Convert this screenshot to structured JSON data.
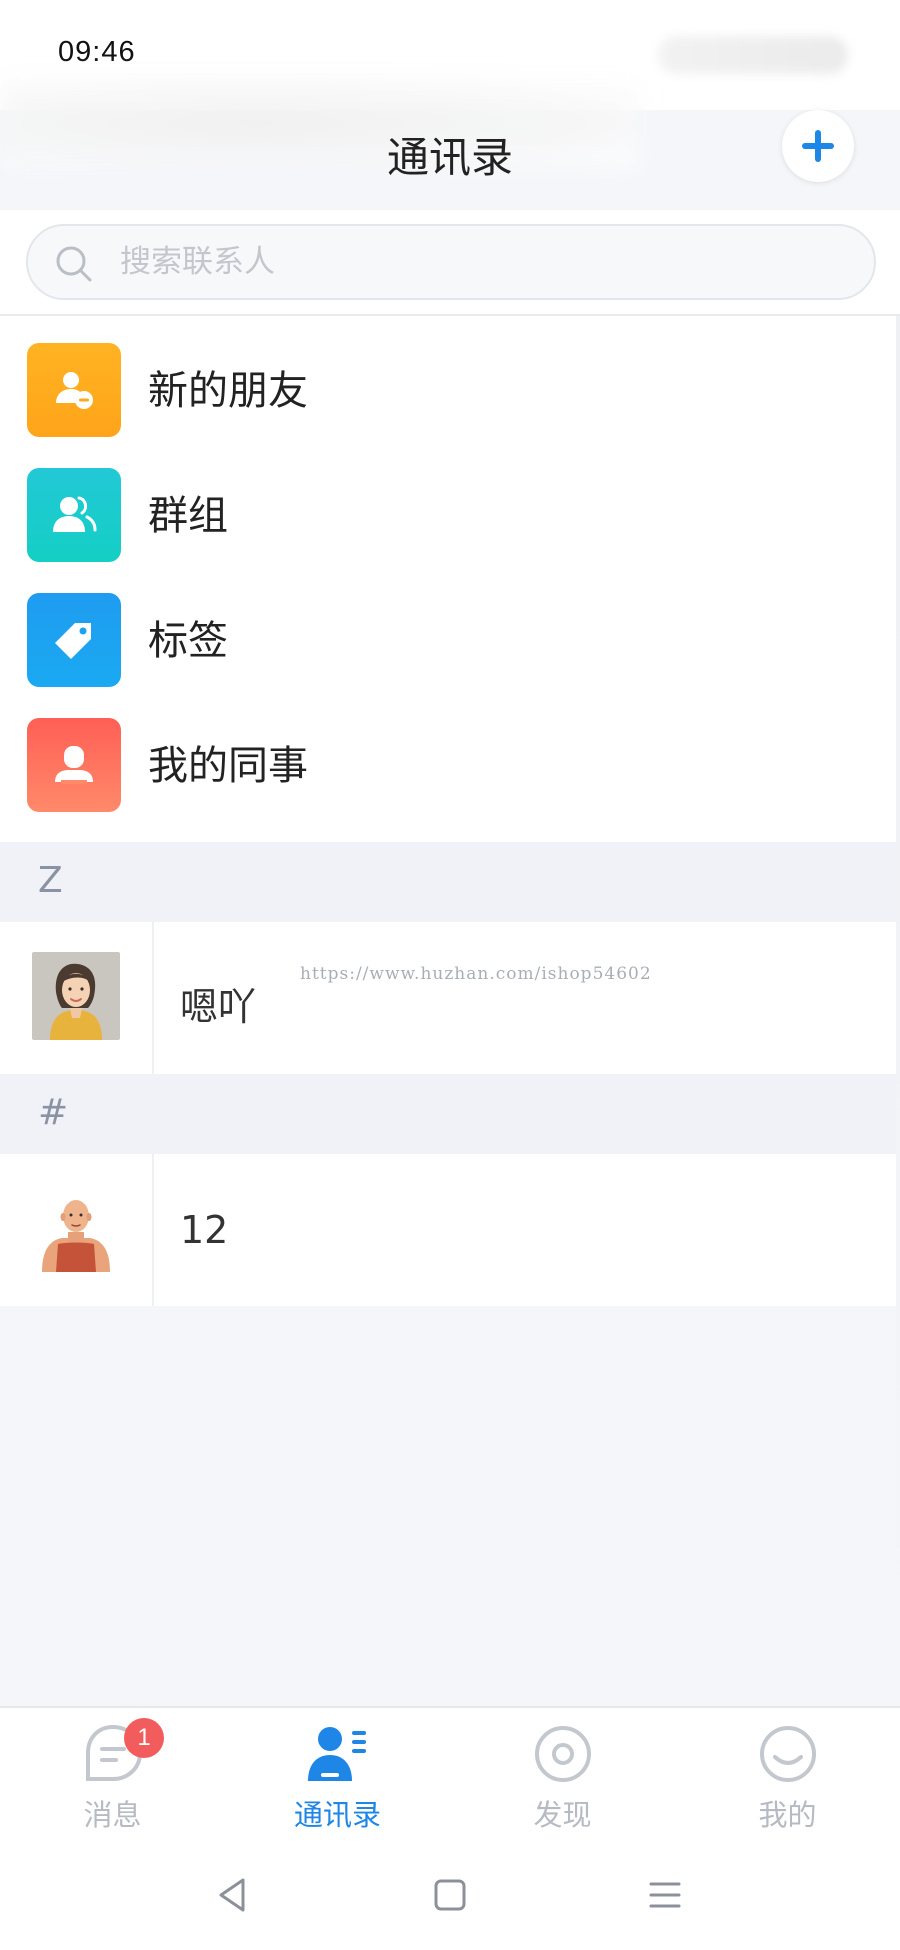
{
  "status": {
    "time": "09:46"
  },
  "header": {
    "title": "通讯录"
  },
  "search": {
    "placeholder": "搜索联系人",
    "value": ""
  },
  "menu": [
    {
      "label": "新的朋友",
      "icon": "new-friend-icon",
      "color": "#FFAF1C"
    },
    {
      "label": "群组",
      "icon": "group-icon",
      "color": "#1EC8D2"
    },
    {
      "label": "标签",
      "icon": "tag-icon",
      "color": "#1BA2F0"
    },
    {
      "label": "我的同事",
      "icon": "colleague-icon",
      "color": "#FF6B5E"
    }
  ],
  "sections": [
    {
      "letter": "Z",
      "contacts": [
        {
          "name": "嗯吖",
          "avatar": "woman-avatar"
        }
      ]
    },
    {
      "letter": "#",
      "contacts": [
        {
          "name": "12",
          "avatar": "man-avatar"
        }
      ]
    }
  ],
  "watermark": "https://www.huzhan.com/ishop54602",
  "tabs": [
    {
      "label": "消息",
      "icon": "message-icon",
      "badge": "1",
      "active": false
    },
    {
      "label": "通讯录",
      "icon": "contacts-icon",
      "active": true
    },
    {
      "label": "发现",
      "icon": "discover-icon",
      "active": false
    },
    {
      "label": "我的",
      "icon": "profile-icon",
      "active": false
    }
  ],
  "colors": {
    "accent": "#1D86E6",
    "badge": "#F25C5C",
    "section_bg": "#F0F2F7"
  }
}
